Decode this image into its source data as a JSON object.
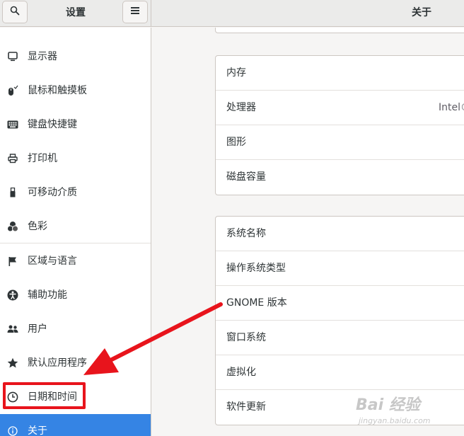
{
  "header": {
    "left_title": "设置",
    "right_title": "关于",
    "search_icon": "search-icon",
    "menu_icon": "hamburger-menu-icon"
  },
  "sidebar": {
    "items": [
      {
        "label": "显示器",
        "icon": "display-icon"
      },
      {
        "label": "鼠标和触摸板",
        "icon": "mouse-icon"
      },
      {
        "label": "键盘快捷键",
        "icon": "keyboard-icon"
      },
      {
        "label": "打印机",
        "icon": "printer-icon"
      },
      {
        "label": "可移动介质",
        "icon": "usb-drive-icon"
      },
      {
        "label": "色彩",
        "icon": "color-icon"
      },
      {
        "label": "区域与语言",
        "icon": "flag-icon"
      },
      {
        "label": "辅助功能",
        "icon": "accessibility-icon"
      },
      {
        "label": "用户",
        "icon": "users-icon"
      },
      {
        "label": "默认应用程序",
        "icon": "star-icon"
      },
      {
        "label": "日期和时间",
        "icon": "clock-icon"
      },
      {
        "label": "关于",
        "icon": "info-icon",
        "selected": true
      }
    ]
  },
  "main": {
    "hardware_rows": [
      {
        "label": "内存",
        "value": ""
      },
      {
        "label": "处理器",
        "value": "Intel®"
      },
      {
        "label": "图形",
        "value": ""
      },
      {
        "label": "磁盘容量",
        "value": ""
      }
    ],
    "system_rows": [
      {
        "label": "系统名称"
      },
      {
        "label": "操作系统类型"
      },
      {
        "label": "GNOME 版本"
      },
      {
        "label": "窗口系统"
      },
      {
        "label": "虚拟化"
      },
      {
        "label": "软件更新"
      }
    ]
  },
  "annotation": {
    "color": "#e8141c"
  },
  "watermark": {
    "text": "Bai 经验",
    "sub": "jingyan.baidu.com"
  },
  "colors": {
    "accent": "#3584e4",
    "annotation_red": "#e8141c"
  }
}
